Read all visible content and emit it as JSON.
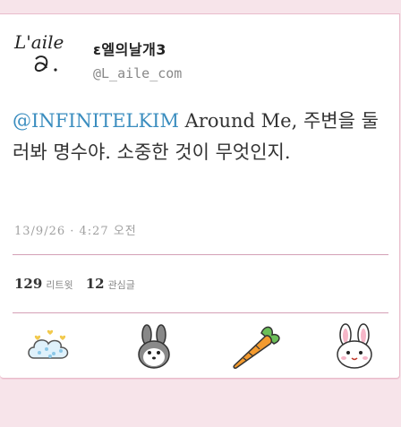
{
  "profile": {
    "display_name": "ε엘의날개3",
    "handle": "@L_aile_com",
    "avatar_text": "L'aile"
  },
  "tweet": {
    "mention": "@INFINITELKIM",
    "text_after_mention": " Around Me, 주변을 둘러봐 명수야. 소중한 것이 무엇인지.",
    "timestamp": "13/9/26 · 4:27 오전"
  },
  "stats": {
    "retweets_count": "129",
    "retweets_label": "리트윗",
    "favorites_count": "12",
    "favorites_label": "관심글"
  },
  "actions": [
    {
      "icon": "cloud-hearts-icon"
    },
    {
      "icon": "bunny-ears-icon"
    },
    {
      "icon": "carrot-icon"
    },
    {
      "icon": "rabbit-face-icon"
    }
  ],
  "colors": {
    "mention": "#3a8dbf",
    "background": "#f7e4ea",
    "divider": "#d4a0b6"
  }
}
